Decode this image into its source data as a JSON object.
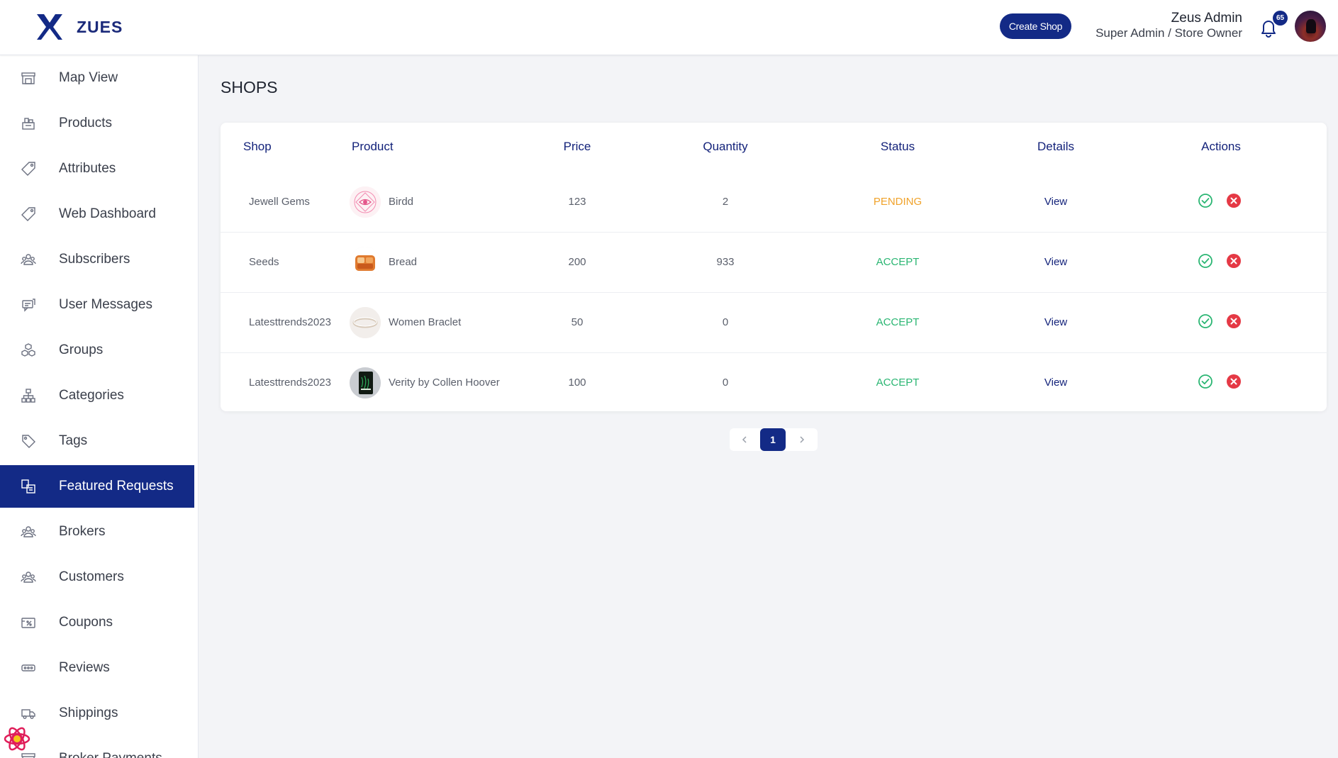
{
  "app": {
    "name": "ZUES"
  },
  "header": {
    "create_button": "Create Shop",
    "user_name": "Zeus Admin",
    "user_role": "Super Admin / Store Owner",
    "notification_count": "65"
  },
  "sidebar": {
    "items": [
      {
        "label": "Map View",
        "icon": "store-icon"
      },
      {
        "label": "Products",
        "icon": "products-icon"
      },
      {
        "label": "Attributes",
        "icon": "tag-icon"
      },
      {
        "label": "Web Dashboard",
        "icon": "tag-icon"
      },
      {
        "label": "Subscribers",
        "icon": "users-icon"
      },
      {
        "label": "User Messages",
        "icon": "message-icon"
      },
      {
        "label": "Groups",
        "icon": "groups-icon"
      },
      {
        "label": "Categories",
        "icon": "hierarchy-icon"
      },
      {
        "label": "Tags",
        "icon": "tag-icon"
      },
      {
        "label": "Featured Requests",
        "icon": "featured-icon",
        "active": true
      },
      {
        "label": "Brokers",
        "icon": "users-icon"
      },
      {
        "label": "Customers",
        "icon": "users-icon"
      },
      {
        "label": "Coupons",
        "icon": "coupon-icon"
      },
      {
        "label": "Reviews",
        "icon": "reviews-icon"
      },
      {
        "label": "Shippings",
        "icon": "truck-icon"
      },
      {
        "label": "Broker Payments",
        "icon": "store-icon"
      }
    ]
  },
  "page": {
    "title": "SHOPS"
  },
  "table": {
    "headers": {
      "shop": "Shop",
      "product": "Product",
      "price": "Price",
      "quantity": "Quantity",
      "status": "Status",
      "details": "Details",
      "actions": "Actions"
    },
    "rows": [
      {
        "shop": "Jewell Gems",
        "product": "Birdd",
        "price": "123",
        "quantity": "2",
        "status": "PENDING",
        "details": "View"
      },
      {
        "shop": "Seeds",
        "product": "Bread",
        "price": "200",
        "quantity": "933",
        "status": "ACCEPT",
        "details": "View"
      },
      {
        "shop": "Latesttrends2023",
        "product": "Women Braclet",
        "price": "50",
        "quantity": "0",
        "status": "ACCEPT",
        "details": "View"
      },
      {
        "shop": "Latesttrends2023",
        "product": "Verity by Collen Hoover",
        "price": "100",
        "quantity": "0",
        "status": "ACCEPT",
        "details": "View"
      }
    ]
  },
  "pagination": {
    "current_page": "1"
  },
  "colors": {
    "primary": "#132a86",
    "pending": "#f0a22a",
    "accept": "#2bb673",
    "reject": "#e53945"
  }
}
